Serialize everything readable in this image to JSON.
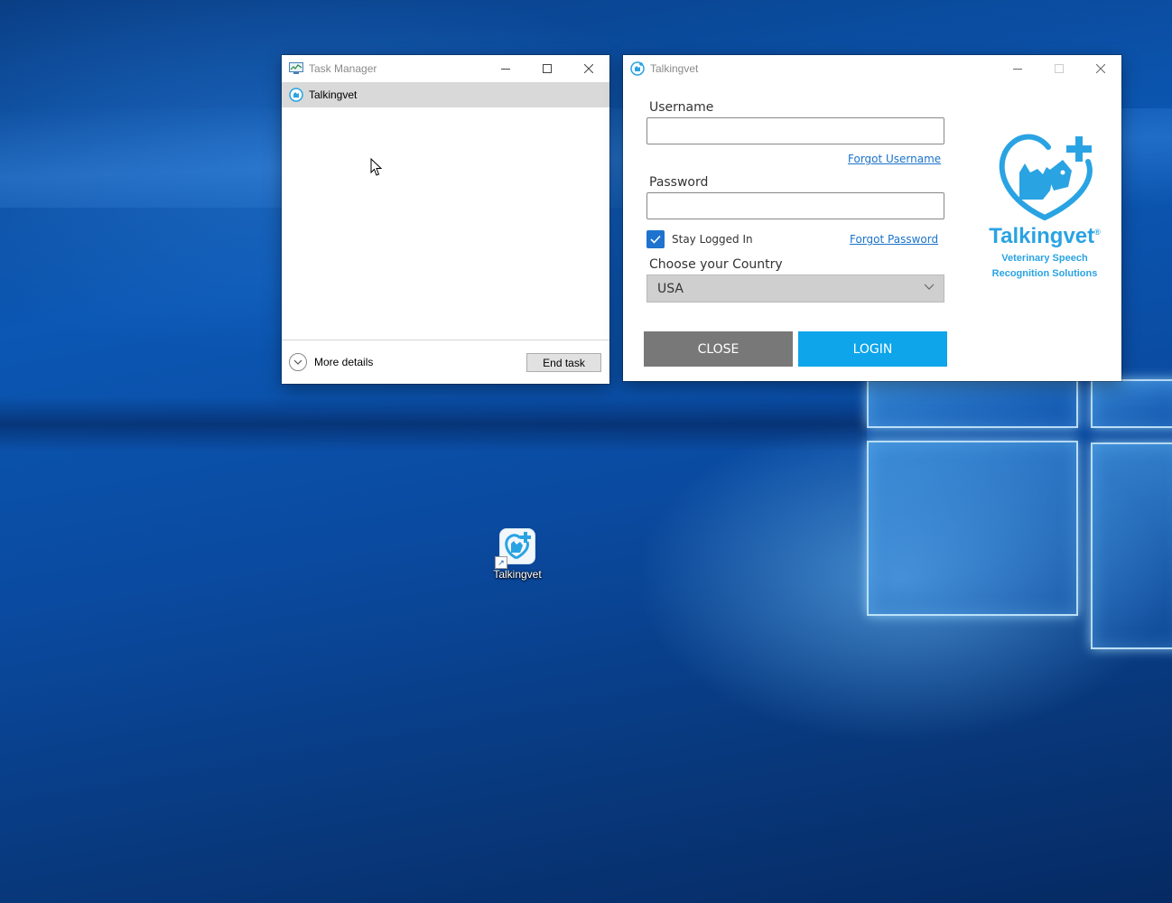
{
  "task_manager": {
    "title": "Task Manager",
    "process": "Talkingvet",
    "more_details": "More details",
    "end_task": "End task"
  },
  "talkingvet": {
    "title": "Talkingvet",
    "username_label": "Username",
    "username_value": "",
    "forgot_username": "Forgot Username",
    "password_label": "Password",
    "password_value": "",
    "stay_logged_in": "Stay Logged In",
    "stay_logged_in_checked": true,
    "forgot_password": "Forgot Password",
    "country_label": "Choose your Country",
    "country_selected": "USA",
    "close_label": "CLOSE",
    "login_label": "LOGIN",
    "brand_name": "Talkingvet",
    "brand_registered": "®",
    "brand_tagline_1": "Veterinary Speech",
    "brand_tagline_2": "Recognition Solutions",
    "colors": {
      "accent": "#2aa3e3",
      "login_button": "#0ea5ea",
      "close_button": "#787878",
      "checkbox": "#1e73cf",
      "link": "#1a73c9"
    }
  },
  "desktop": {
    "icon_label": "Talkingvet"
  }
}
